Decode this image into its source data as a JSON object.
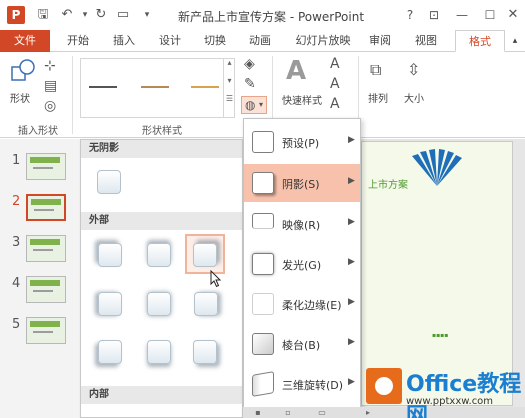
{
  "window": {
    "title": "新产品上市宣传方案 - PowerPoint",
    "app_logo": "P",
    "help": "?",
    "restore": "⊡",
    "minimize": "—",
    "maximize": "☐"
  },
  "ribbon_tabs": [
    {
      "label": "文件"
    },
    {
      "label": "开始"
    },
    {
      "label": "插入"
    },
    {
      "label": "设计"
    },
    {
      "label": "切换"
    },
    {
      "label": "动画"
    },
    {
      "label": "幻灯片放映"
    },
    {
      "label": "审阅"
    },
    {
      "label": "视图"
    },
    {
      "label": "格式"
    }
  ],
  "ribbon": {
    "insert_shapes": {
      "shapes_label": "形状",
      "group_label": "插入形状"
    },
    "shape_styles": {
      "group_label": "形状样式"
    },
    "quick_styles_label": "快速样式",
    "arrange_label": "排列",
    "size_label": "大小"
  },
  "slides": [
    {
      "number": "1"
    },
    {
      "number": "2"
    },
    {
      "number": "3"
    },
    {
      "number": "4"
    },
    {
      "number": "5"
    }
  ],
  "shadow_gallery": {
    "no_shadow": "无阴影",
    "outer": "外部",
    "inner": "内部"
  },
  "effects_menu": [
    {
      "label": "预设(P)",
      "icon": "preset-icon"
    },
    {
      "label": "阴影(S)",
      "icon": "shadow-icon"
    },
    {
      "label": "映像(R)",
      "icon": "reflection-icon"
    },
    {
      "label": "发光(G)",
      "icon": "glow-icon"
    },
    {
      "label": "柔化边缘(E)",
      "icon": "soft-edges-icon"
    },
    {
      "label": "棱台(B)",
      "icon": "bevel-icon"
    },
    {
      "label": "三维旋转(D)",
      "icon": "3d-rotation-icon"
    }
  ],
  "slide_canvas": {
    "title_fragment": "上市方案"
  },
  "watermark": {
    "brand": "Office教程网",
    "url": "www.pptxxw.com"
  },
  "colors": {
    "accent": "#d24726",
    "highlight": "#f7c1ab",
    "slide_green": "#7fb24a"
  }
}
